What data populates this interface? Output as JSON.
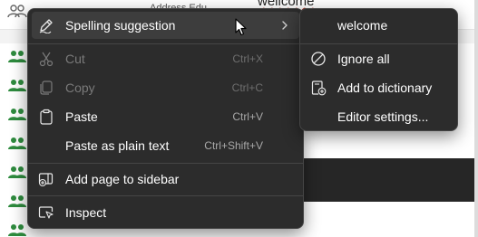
{
  "background": {
    "top_text": "wellcome",
    "address_text": "Address  Edu",
    "row_count": 8
  },
  "main_menu": {
    "items": [
      {
        "label": "Spelling suggestion",
        "shortcut": "",
        "icon": "spelling-pen-icon",
        "disabled": false,
        "has_submenu": true
      },
      {
        "label": "Cut",
        "shortcut": "Ctrl+X",
        "icon": "scissors-icon",
        "disabled": true
      },
      {
        "label": "Copy",
        "shortcut": "Ctrl+C",
        "icon": "copy-icon",
        "disabled": true
      },
      {
        "label": "Paste",
        "shortcut": "Ctrl+V",
        "icon": "clipboard-icon",
        "disabled": false
      },
      {
        "label": "Paste as plain text",
        "shortcut": "Ctrl+Shift+V",
        "icon": "",
        "disabled": false
      },
      {
        "label": "Add page to sidebar",
        "shortcut": "",
        "icon": "sidebar-add-icon",
        "disabled": false
      },
      {
        "label": "Inspect",
        "shortcut": "",
        "icon": "inspect-icon",
        "disabled": false
      }
    ]
  },
  "sub_menu": {
    "items": [
      {
        "label": "welcome",
        "icon": ""
      },
      {
        "label": "Ignore all",
        "icon": "ignore-circle-icon"
      },
      {
        "label": "Add to dictionary",
        "icon": "dictionary-add-icon"
      },
      {
        "label": "Editor settings...",
        "icon": ""
      }
    ]
  },
  "colors": {
    "menu_bg": "#2c2c2c",
    "hover_bg": "#3d3d3d",
    "accent_people": "#2e8b3e",
    "misspelling_underline": "#c42b1c"
  }
}
